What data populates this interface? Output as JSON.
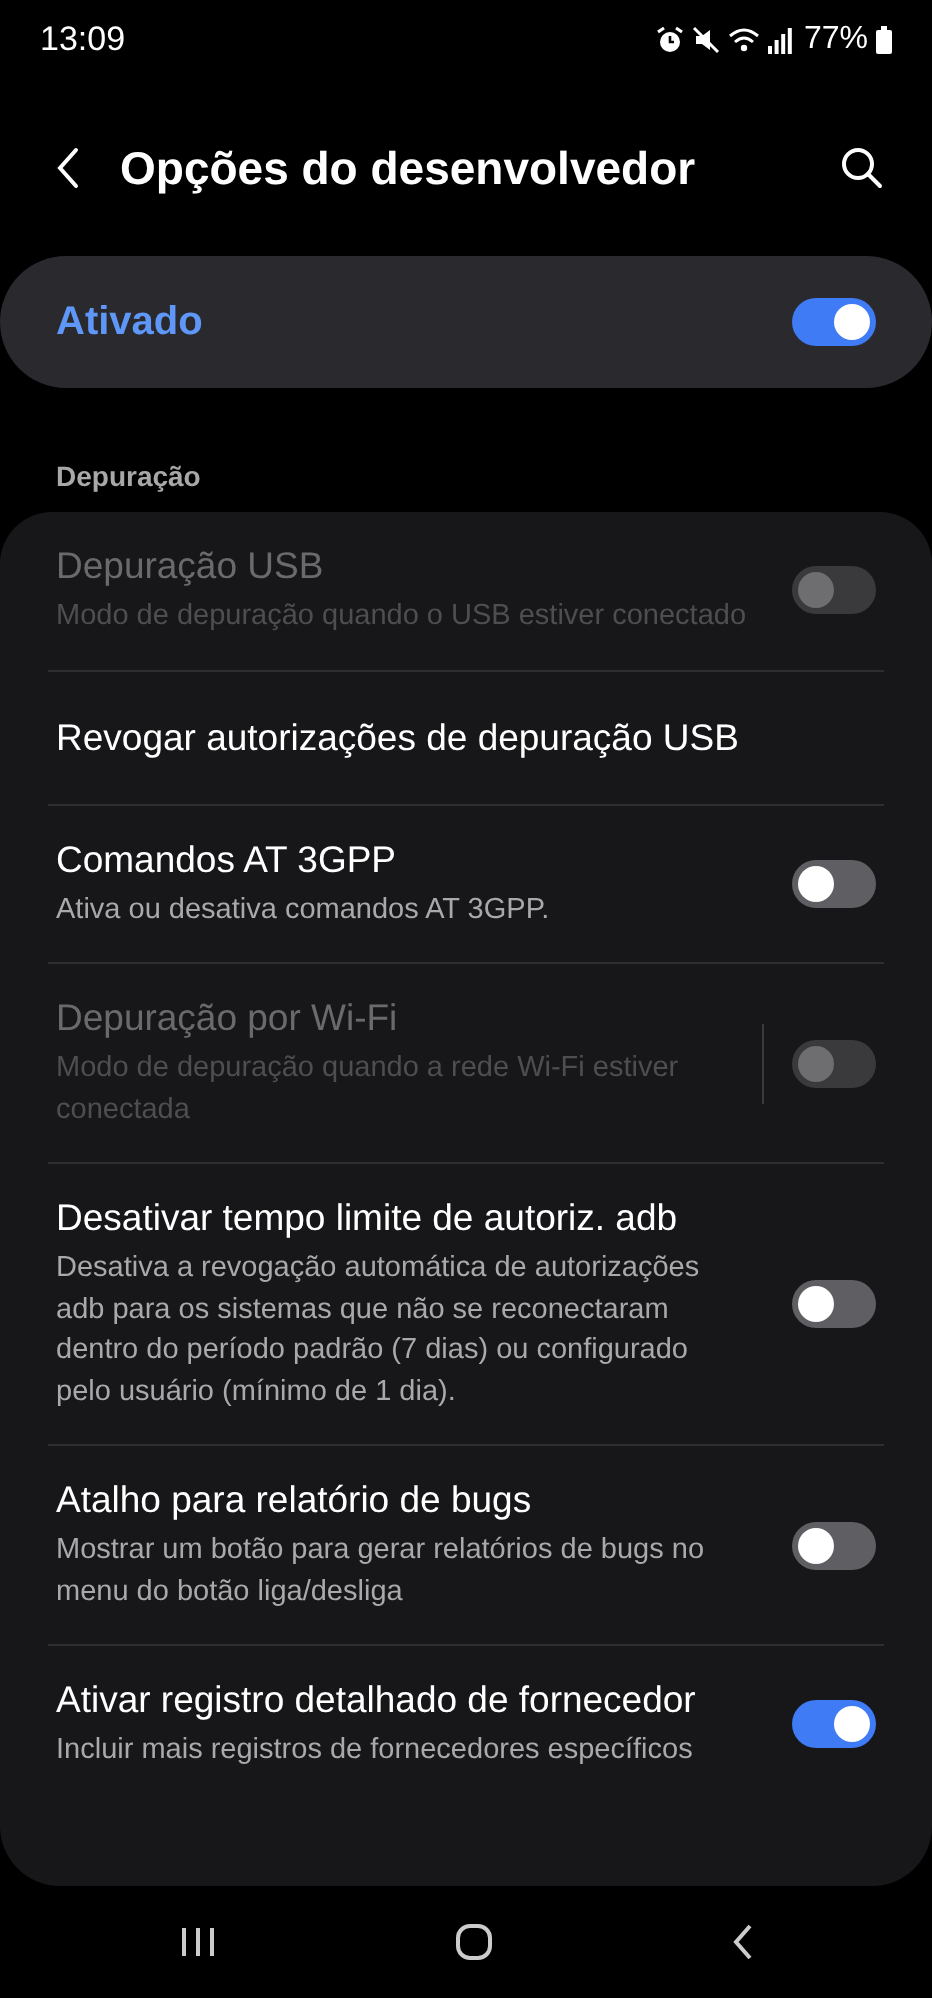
{
  "status_bar": {
    "time": "13:09",
    "battery": "77%"
  },
  "header": {
    "title": "Opções do desenvolvedor"
  },
  "master": {
    "label": "Ativado",
    "on": true
  },
  "section": {
    "title": "Depuração"
  },
  "items": [
    {
      "kind": "toggle",
      "title": "Depuração USB",
      "subtitle": "Modo de depuração quando o USB estiver conectado",
      "disabled": true,
      "on": false,
      "divider": false
    },
    {
      "kind": "action",
      "title": "Revogar autorizações de depuração USB",
      "disabled": false
    },
    {
      "kind": "toggle",
      "title": "Comandos AT 3GPP",
      "subtitle": "Ativa ou desativa comandos AT 3GPP.",
      "disabled": false,
      "on": false,
      "divider": false
    },
    {
      "kind": "toggle",
      "title": "Depuração por Wi-Fi",
      "subtitle": "Modo de depuração quando a rede Wi-Fi estiver conectada",
      "disabled": true,
      "on": false,
      "divider": true
    },
    {
      "kind": "toggle",
      "title": "Desativar tempo limite de autoriz. adb",
      "subtitle": "Desativa a revogação automática de autorizações adb para os sistemas que não se reconectaram dentro do período padrão (7 dias) ou configurado pelo usuário (mínimo de 1 dia).",
      "disabled": false,
      "on": false,
      "divider": false
    },
    {
      "kind": "toggle",
      "title": "Atalho para relatório de bugs",
      "subtitle": "Mostrar um botão para gerar relatórios de bugs no menu do botão liga/desliga",
      "disabled": false,
      "on": false,
      "divider": false
    },
    {
      "kind": "toggle",
      "title": "Ativar registro detalhado de fornecedor",
      "subtitle": "Incluir mais registros de fornecedores específicos",
      "disabled": false,
      "on": true,
      "divider": false
    }
  ]
}
